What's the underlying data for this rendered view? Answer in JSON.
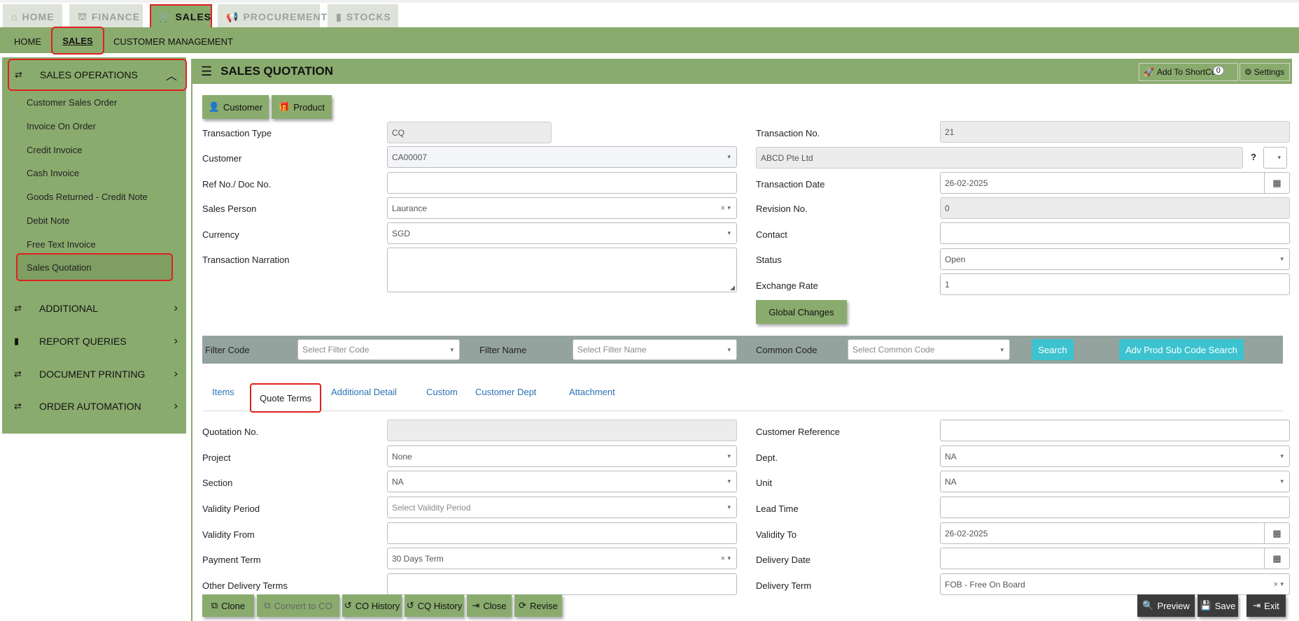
{
  "top_tabs": [
    {
      "label": "HOME",
      "icon": "home-icon"
    },
    {
      "label": "FINANCE",
      "icon": "bank-icon"
    },
    {
      "label": "SALES",
      "icon": "cart-icon"
    },
    {
      "label": "PROCUREMENT",
      "icon": "megaphone-icon"
    },
    {
      "label": "STOCKS",
      "icon": "bar-chart-icon"
    }
  ],
  "sub_nav": [
    "HOME",
    "SALES",
    "CUSTOMER MANAGEMENT"
  ],
  "sidebar": {
    "sales_operations": "SALES OPERATIONS",
    "items": [
      "Customer Sales Order",
      "Invoice On Order",
      "Credit Invoice",
      "Cash Invoice",
      "Goods Returned - Credit Note",
      "Debit Note",
      "Free Text Invoice",
      "Sales Quotation"
    ],
    "groups": [
      "ADDITIONAL",
      "REPORT QUERIES",
      "DOCUMENT PRINTING",
      "ORDER AUTOMATION"
    ]
  },
  "header": {
    "title": "SALES QUOTATION",
    "shortcut": "Add To ShortCut",
    "shortcut_count": "0",
    "settings": "Settings"
  },
  "quick": {
    "customer": "Customer",
    "product": "Product"
  },
  "form": {
    "transaction_type_label": "Transaction Type",
    "transaction_type": "CQ",
    "customer_label": "Customer",
    "customer": "CA00007",
    "ref_label": "Ref No./ Doc No.",
    "ref": "",
    "sales_person_label": "Sales Person",
    "sales_person": "Laurance",
    "currency_label": "Currency",
    "currency": "SGD",
    "narration_label": "Transaction Narration",
    "narration": "",
    "transaction_no_label": "Transaction No.",
    "transaction_no": "21",
    "customer_name": "ABCD Pte Ltd",
    "question": "?",
    "transaction_date_label": "Transaction Date",
    "transaction_date": "26-02-2025",
    "revision_label": "Revision No.",
    "revision": "0",
    "contact_label": "Contact",
    "contact": "",
    "status_label": "Status",
    "status": "Open",
    "exchange_label": "Exchange Rate",
    "exchange": "1",
    "global_changes": "Global Changes"
  },
  "filter": {
    "filter_code_label": "Filter Code",
    "filter_code_ph": "Select Filter Code",
    "filter_name_label": "Filter Name",
    "filter_name_ph": "Select Filter Name",
    "common_code_label": "Common Code",
    "common_code_ph": "Select Common Code",
    "search": "Search",
    "adv": "Adv Prod Sub Code Search"
  },
  "tabs": [
    "Items",
    "Quote Terms",
    "Additional Detail",
    "Custom",
    "Customer Dept",
    "Attachment"
  ],
  "quote": {
    "quotation_no_label": "Quotation No.",
    "quotation_no": "",
    "project_label": "Project",
    "project": "None",
    "section_label": "Section",
    "section": "NA",
    "validity_period_label": "Validity Period",
    "validity_period_ph": "Select Validity Period",
    "validity_from_label": "Validity From",
    "validity_from": "",
    "payment_term_label": "Payment Term",
    "payment_term": "30 Days Term",
    "other_delivery_label": "Other Delivery Terms",
    "other_delivery": "",
    "customer_ref_label": "Customer Reference",
    "customer_ref": "",
    "dept_label": "Dept.",
    "dept": "NA",
    "unit_label": "Unit",
    "unit": "NA",
    "lead_time_label": "Lead Time",
    "lead_time": "",
    "validity_to_label": "Validity To",
    "validity_to": "26-02-2025",
    "delivery_date_label": "Delivery Date",
    "delivery_date": "",
    "delivery_term_label": "Delivery Term",
    "delivery_term": "FOB - Free On Board"
  },
  "actions": {
    "clone": "Clone",
    "convert": "Convert to CO",
    "co_history": "CO History",
    "cq_history": "CQ History",
    "close": "Close",
    "revise": "Revise",
    "preview": "Preview",
    "save": "Save",
    "exit": "Exit"
  },
  "colors": {
    "accent": "#8aab6e",
    "highlight": "#e02020",
    "cyan": "#3cc3cf"
  }
}
